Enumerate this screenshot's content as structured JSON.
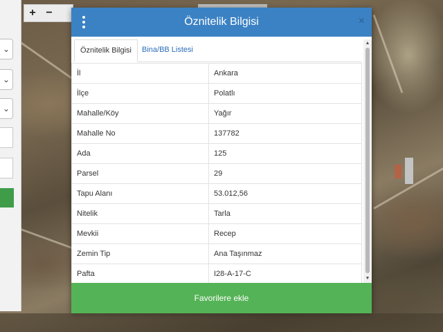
{
  "map_toolbar": {
    "zoom_in": "+",
    "zoom_out": "−"
  },
  "sidebar": {
    "select_arrow": "⌄"
  },
  "dialog": {
    "title": "Öznitelik Bilgisi",
    "menu_icon": "vertical-ellipsis-icon",
    "close_icon": "×",
    "tabs": [
      {
        "label": "Öznitelik Bilgisi",
        "active": true
      },
      {
        "label": "Bina/BB Listesi",
        "active": false
      }
    ],
    "rows": [
      {
        "key": "İl",
        "value": "Ankara"
      },
      {
        "key": "İlçe",
        "value": "Polatlı"
      },
      {
        "key": "Mahalle/Köy",
        "value": "Yağır"
      },
      {
        "key": "Mahalle No",
        "value": "137782"
      },
      {
        "key": "Ada",
        "value": "125"
      },
      {
        "key": "Parsel",
        "value": "29"
      },
      {
        "key": "Tapu Alanı",
        "value": "53.012,56"
      },
      {
        "key": "Nitelik",
        "value": "Tarla"
      },
      {
        "key": "Mevkii",
        "value": "Recep"
      },
      {
        "key": "Zemin Tip",
        "value": "Ana Taşınmaz"
      },
      {
        "key": "Pafta",
        "value": "I28-A-17-C"
      }
    ],
    "favorite_button": "Favorilere ekle"
  },
  "colors": {
    "header": "#3b82c4",
    "button": "#55b357",
    "tab_link": "#2a6ebb"
  }
}
